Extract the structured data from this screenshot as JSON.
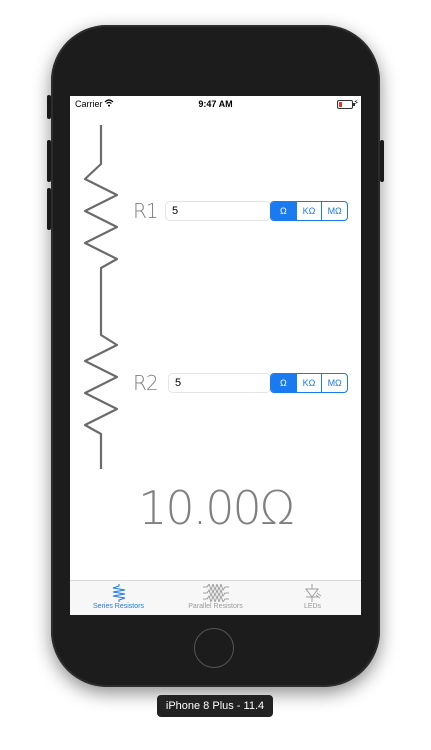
{
  "device": {
    "label": "iPhone 8 Plus - 11.4"
  },
  "status_bar": {
    "carrier": "Carrier",
    "time": "9:47 AM",
    "battery": "low"
  },
  "resistors": [
    {
      "label": "R1",
      "value": "5",
      "units": [
        "Ω",
        "KΩ",
        "MΩ"
      ],
      "selected_unit": "Ω"
    },
    {
      "label": "R2",
      "value": "5",
      "units": [
        "Ω",
        "KΩ",
        "MΩ"
      ],
      "selected_unit": "Ω"
    }
  ],
  "result": "10.00Ω",
  "tabs": [
    {
      "label": "Series Resistors",
      "icon": "series-resistor-icon",
      "active": true
    },
    {
      "label": "Parallel Resistors",
      "icon": "parallel-resistor-icon",
      "active": false
    },
    {
      "label": "LEDs",
      "icon": "led-icon",
      "active": false
    }
  ],
  "colors": {
    "accent": "#1a7bf0",
    "text_gray": "#808080",
    "frame": "#1c1c1c"
  }
}
